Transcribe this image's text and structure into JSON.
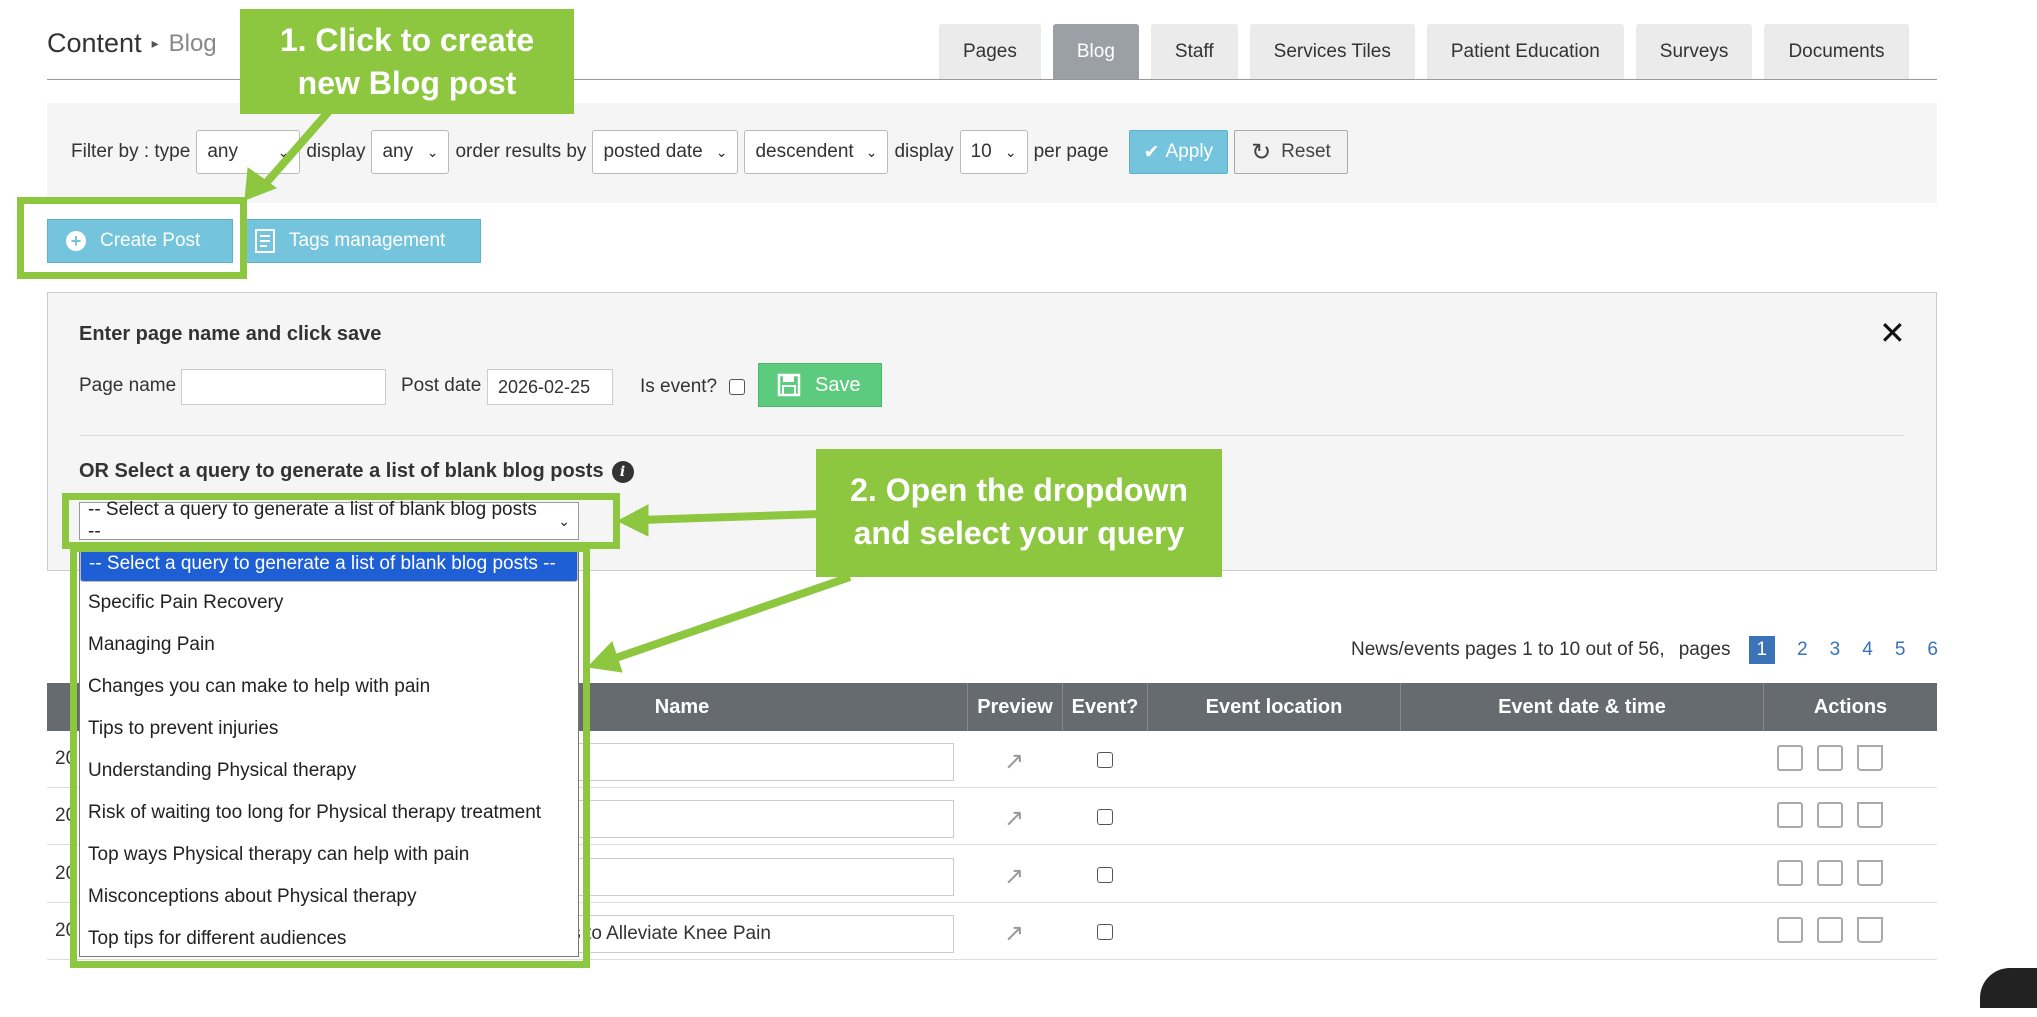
{
  "header": {
    "title": "Content",
    "separator": "▸",
    "subtitle": "Blog"
  },
  "tabs": [
    {
      "label": "Pages",
      "active": false
    },
    {
      "label": "Blog",
      "active": true
    },
    {
      "label": "Staff",
      "active": false
    },
    {
      "label": "Services Tiles",
      "active": false
    },
    {
      "label": "Patient Education",
      "active": false
    },
    {
      "label": "Surveys",
      "active": false
    },
    {
      "label": "Documents",
      "active": false
    }
  ],
  "filter": {
    "prefix": "Filter by : type",
    "type_value": "any",
    "display_label": "display",
    "display_value": "any",
    "order_label": "order results by",
    "order_value": "posted date",
    "direction_value": "descendent",
    "display2_label": "display",
    "count_value": "10",
    "per_page": "per page",
    "apply_label": "Apply",
    "reset_label": "Reset"
  },
  "actions": {
    "create_label": "Create Post",
    "tags_label": "Tags management"
  },
  "create_panel": {
    "heading": "Enter page name and click save",
    "page_name_label": "Page name",
    "page_name_value": "",
    "post_date_label": "Post date",
    "post_date_value": "2026-02-25",
    "is_event_label": "Is event?",
    "save_label": "Save",
    "or_heading": "OR Select a query to generate a list of blank blog posts",
    "query_selected": "-- Select a query to generate a list of blank blog posts --"
  },
  "dropdown_options": [
    "-- Select a query to generate a list of blank blog posts --",
    "Specific Pain Recovery",
    "Managing Pain",
    "Changes you can make to help with pain",
    "Tips to prevent injuries",
    "Understanding Physical therapy",
    "Risk of waiting too long for Physical therapy treatment",
    "Top ways Physical therapy can help with pain",
    "Misconceptions about Physical therapy",
    "Top tips for different audiences"
  ],
  "pagination": {
    "summary": "News/events pages 1 to 10 out of 56,",
    "pages_label": "pages",
    "pages": [
      "1",
      "2",
      "3",
      "4",
      "5",
      "6"
    ],
    "current": "1"
  },
  "table": {
    "headers": [
      "Name",
      "Preview",
      "Event?",
      "Event location",
      "Event date & time",
      "Actions"
    ],
    "rows": [
      {
        "id": "20",
        "name": ""
      },
      {
        "id": "20",
        "name": ""
      },
      {
        "id": "20",
        "name": ""
      },
      {
        "id": "20",
        "name": "Therapy Techniques to Alleviate Knee Pain"
      }
    ]
  },
  "annotations": {
    "step1": [
      "1. Click to create",
      "new Blog post"
    ],
    "step2": [
      "2. Open the dropdown",
      "and select your query"
    ]
  },
  "colors": {
    "accent_green": "#8dc63f",
    "button_blue": "#74c4dd",
    "save_green": "#5ccb7e",
    "table_header": "#666b70",
    "selected_option": "#1f5fd6"
  }
}
